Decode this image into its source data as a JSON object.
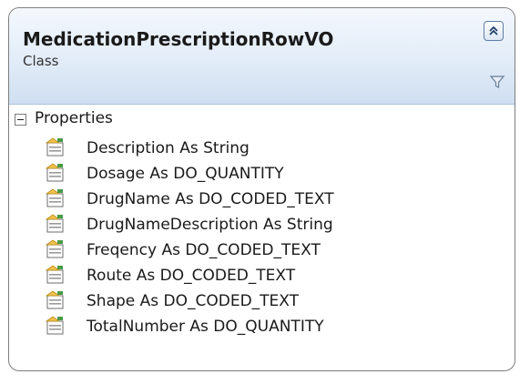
{
  "class_shape": {
    "name": "MedicationPrescriptionRowVO",
    "stereotype": "Class",
    "collapse_icon": "double-chevron-up-icon",
    "filter_icon": "filter-icon"
  },
  "properties_section": {
    "label": "Properties",
    "expander_icon": "minus-box-icon",
    "member_icon": "property-icon",
    "members": [
      "Description As String",
      "Dosage As DO_QUANTITY",
      "DrugName As DO_CODED_TEXT",
      "DrugNameDescription As String",
      "Freqency As DO_CODED_TEXT",
      "Route As DO_CODED_TEXT",
      "Shape As DO_CODED_TEXT",
      "TotalNumber As DO_QUANTITY"
    ]
  },
  "colors": {
    "header_gradient_top": "#f4f8fd",
    "header_gradient_bottom": "#cfdff1",
    "border": "#7d7d7d",
    "button_border": "#5f7ea6"
  }
}
